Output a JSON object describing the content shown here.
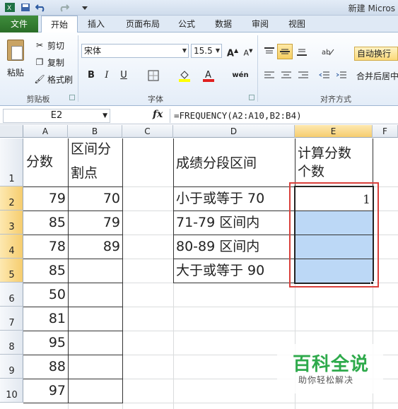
{
  "window": {
    "title": "新建 Micros"
  },
  "ribbon_tabs": [
    {
      "label": "文件"
    },
    {
      "label": "开始"
    },
    {
      "label": "插入"
    },
    {
      "label": "页面布局"
    },
    {
      "label": "公式"
    },
    {
      "label": "数据"
    },
    {
      "label": "审阅"
    },
    {
      "label": "视图"
    }
  ],
  "clipboard": {
    "paste": "粘贴",
    "cut": "剪切",
    "copy": "复制",
    "format_painter": "格式刷",
    "group": "剪贴板"
  },
  "font": {
    "name": "宋体",
    "size": "15.5",
    "group": "字体",
    "bold": "B",
    "italic": "I",
    "underline": "U",
    "grow": "A",
    "shrink": "A",
    "phonetic": "wén"
  },
  "alignment": {
    "wrap": "自动换行",
    "merge": "合并后居中",
    "group": "对齐方式"
  },
  "formula_bar": {
    "name_box": "E2",
    "fx": "fx",
    "formula": "=FREQUENCY(A2:A10,B2:B4)"
  },
  "columns": [
    "A",
    "B",
    "C",
    "D",
    "E",
    "F"
  ],
  "rows": [
    "1",
    "2",
    "3",
    "4",
    "5",
    "6",
    "7",
    "8",
    "9",
    "10"
  ],
  "sheet": {
    "A1": "分数",
    "B1_line1": "区间分",
    "B1_line2": "割点",
    "D1": "成绩分段区间",
    "E1_line1": "计算分数",
    "E1_line2": "个数",
    "A_values": [
      "79",
      "85",
      "78",
      "85",
      "50",
      "81",
      "95",
      "88",
      "97"
    ],
    "B_values": [
      "70",
      "79",
      "89"
    ],
    "D_values": [
      "小于或等于 70",
      "71-79 区间内",
      "80-89 区间内",
      "大于或等于 90"
    ],
    "E2": "1"
  },
  "watermark": {
    "title": "百科全说",
    "subtitle": "助你轻松解决"
  },
  "colors": {
    "selection_fill": "#bcd8f6",
    "highlight_border": "#d9403b",
    "file_tab": "#2e7a2c"
  }
}
